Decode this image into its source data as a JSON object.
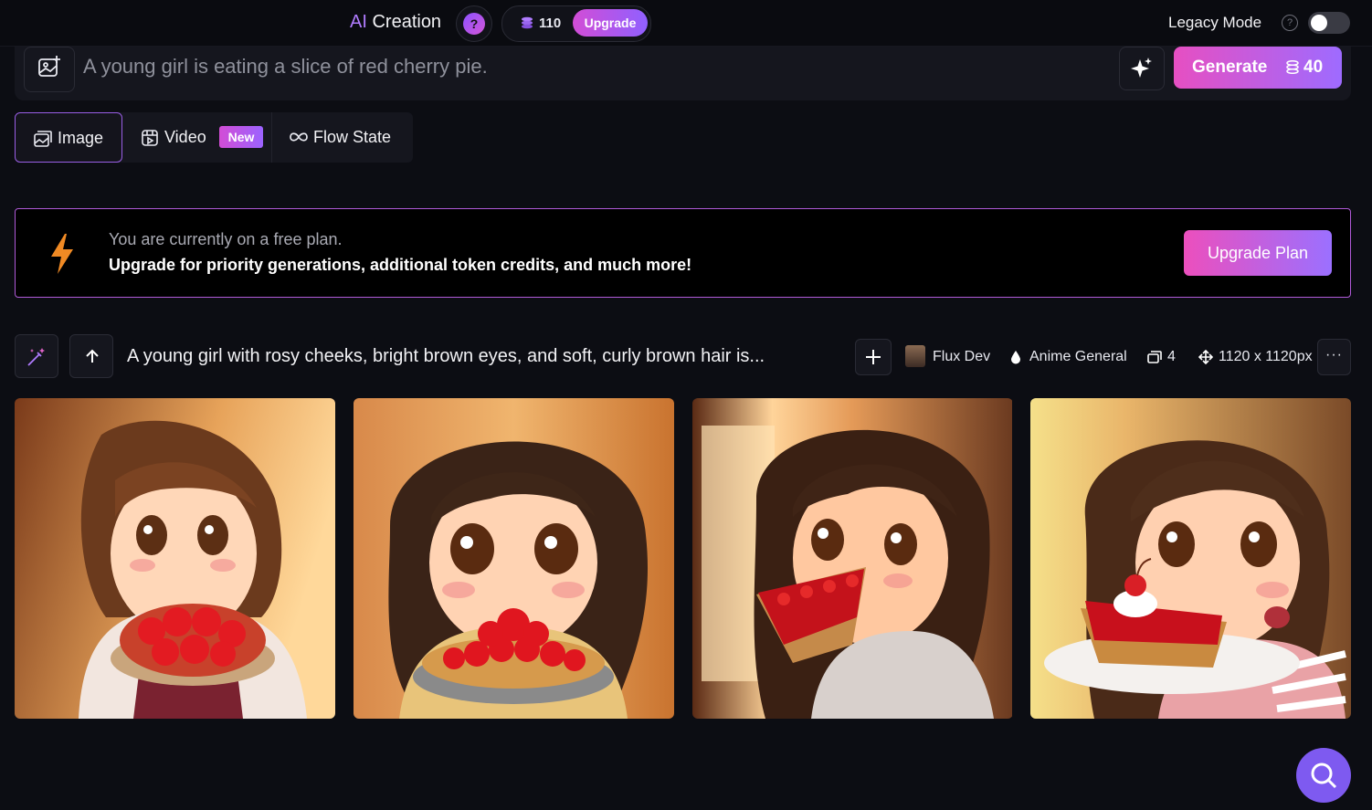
{
  "header": {
    "title_ai": "AI",
    "title_rest": " Creation",
    "help_label": "?",
    "credits": "110",
    "upgrade_label": "Upgrade",
    "legacy_label": "Legacy Mode",
    "legacy_help": "?",
    "legacy_enabled": false
  },
  "prompt_bar": {
    "prompt_text": "A young girl is eating a slice of red cherry pie.",
    "generate_label": "Generate",
    "generate_cost": "40"
  },
  "tabs": [
    {
      "label": "Image",
      "active": true
    },
    {
      "label": "Video",
      "badge": "New"
    },
    {
      "label": "Flow State"
    }
  ],
  "banner": {
    "line1": "You are currently on a free plan.",
    "line2": "Upgrade for priority generations, additional token credits, and much more!",
    "button": "Upgrade Plan"
  },
  "generation": {
    "prompt": "A young girl with rosy cheeks, bright brown eyes, and soft, curly brown hair is...",
    "model": "Flux Dev",
    "style": "Anime General",
    "count": "4",
    "size": "1120 x 1120px",
    "more": "···"
  },
  "images": [
    {
      "alt": "Anime girl eating whole cherry pie"
    },
    {
      "alt": "Anime girl holding cherry pie"
    },
    {
      "alt": "Anime girl biting cherry pie slice"
    },
    {
      "alt": "Anime girl with cherry pie slice on plate"
    }
  ],
  "colors": {
    "accent": "#9c63ff",
    "brand_pink": "#e64fc2",
    "background": "#0c0d13"
  }
}
